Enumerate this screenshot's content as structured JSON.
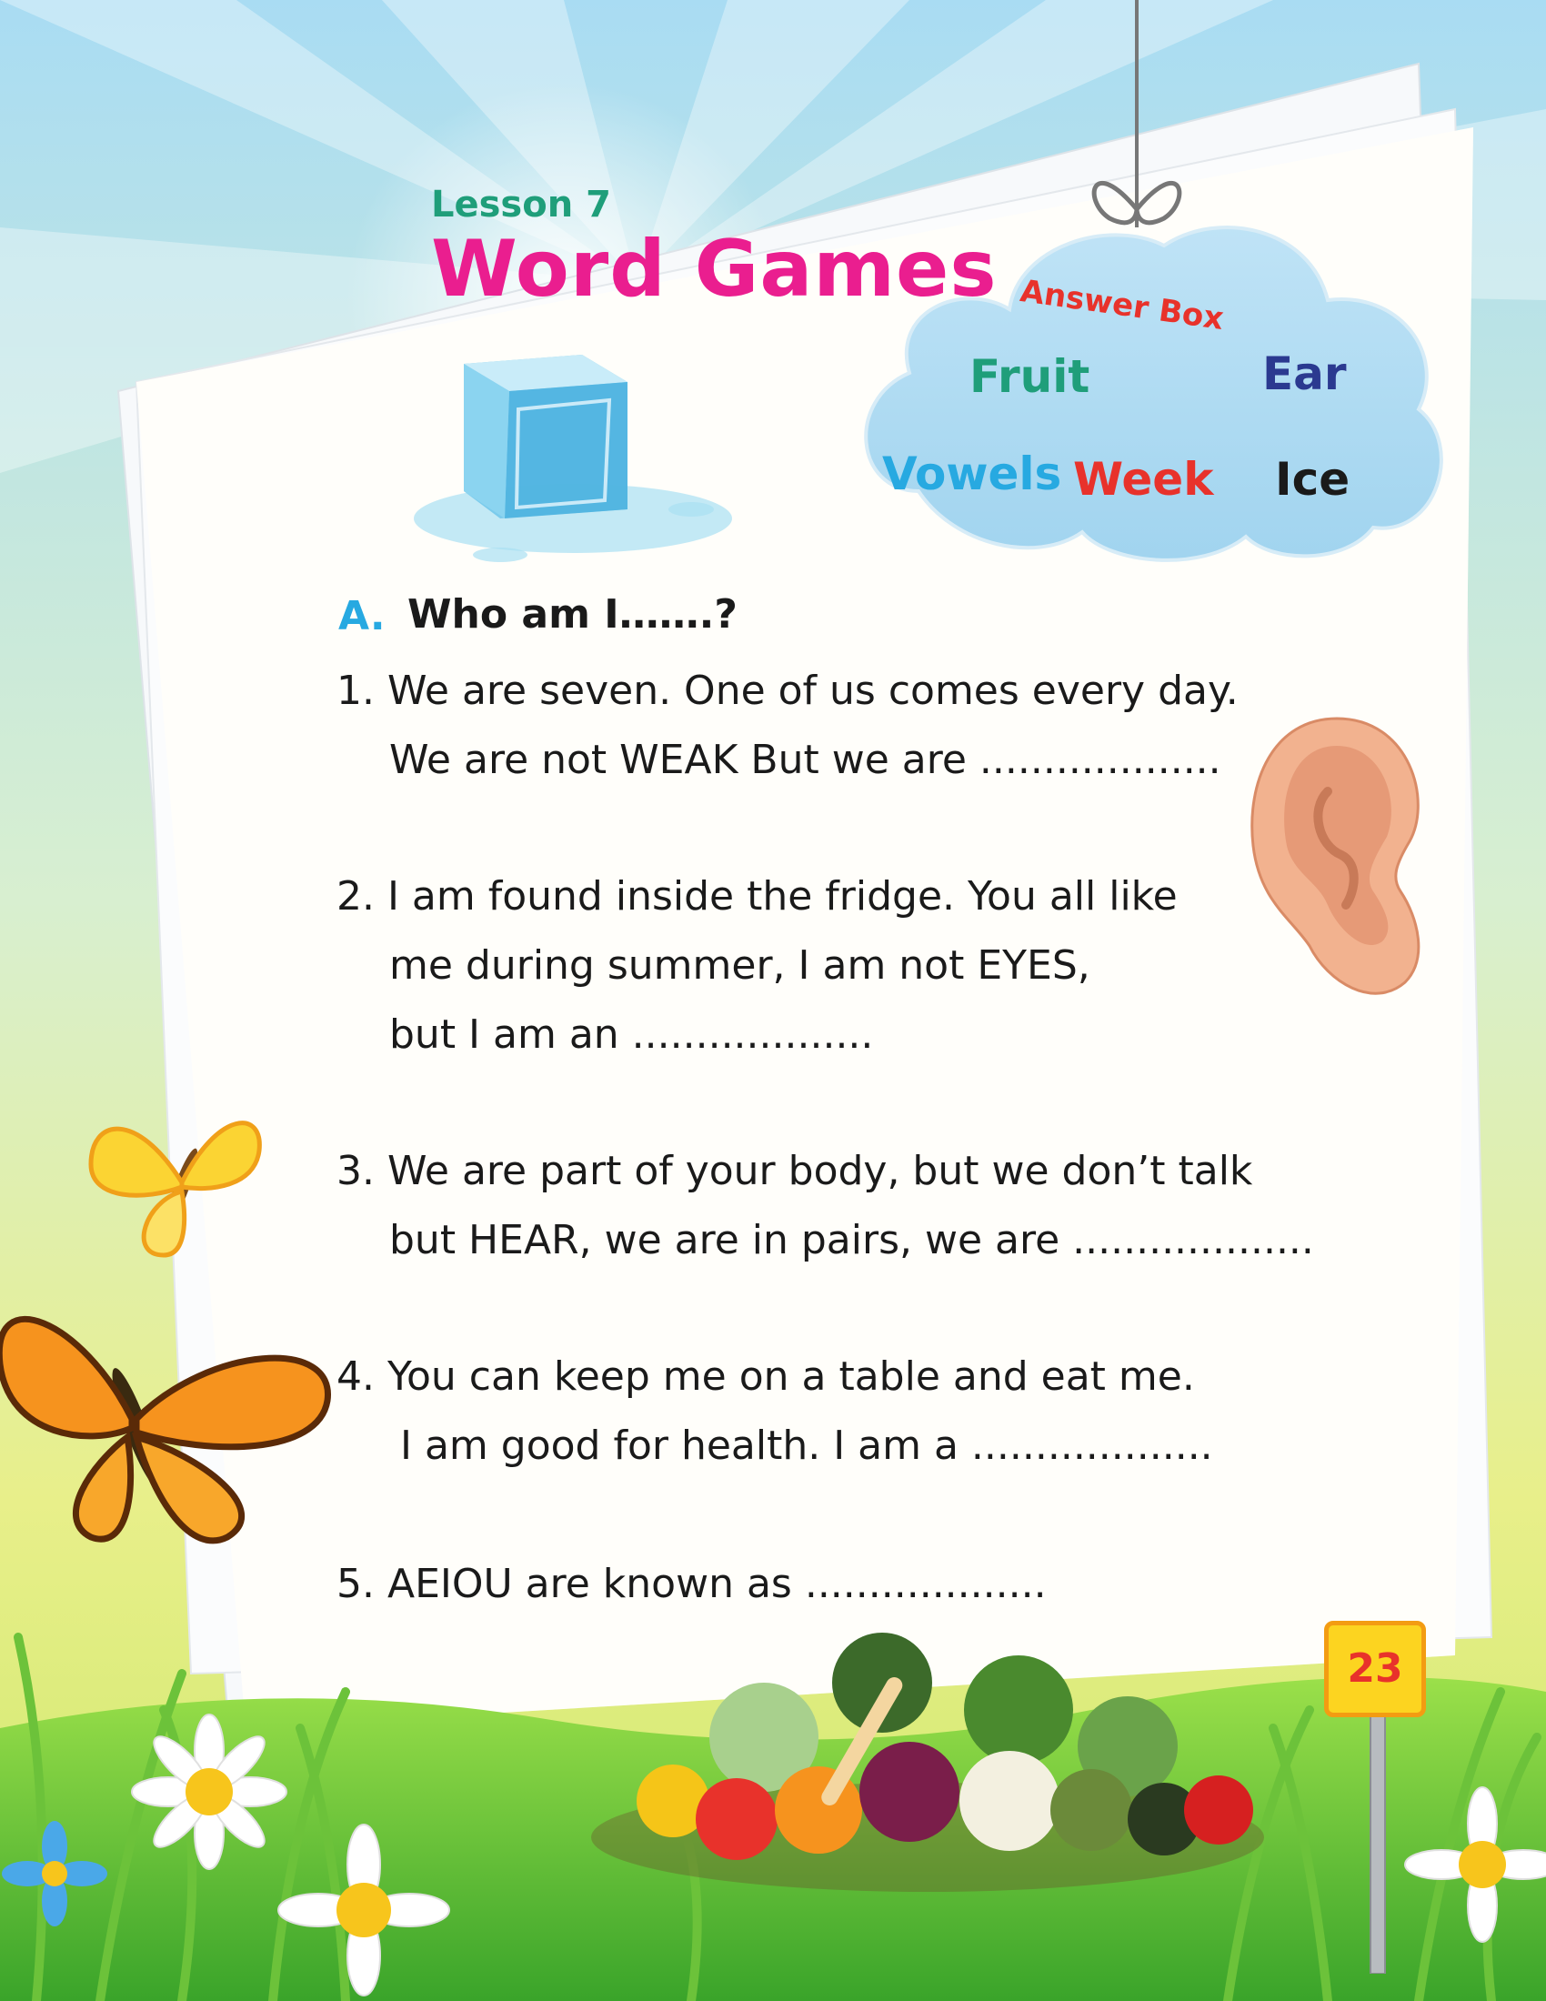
{
  "lesson_label": "Lesson 7",
  "title": "Word Games",
  "answer_box": {
    "title": "Answer Box",
    "words": [
      "Fruit",
      "Ear",
      "Vowels",
      "Week",
      "Ice"
    ],
    "colors": {
      "Fruit": "#1f9e7a",
      "Ear": "#2b3990",
      "Vowels": "#27a9e1",
      "Week": "#e8322b",
      "Ice": "#1a1a1a"
    }
  },
  "section": {
    "letter": "A.",
    "title": "Who am I…….?"
  },
  "questions": [
    {
      "lines": [
        "1. We are seven. One of us comes every day.",
        "We are not WEAK But we are ..................."
      ]
    },
    {
      "lines": [
        "2. I am found inside the fridge. You all like",
        "me during summer, I am not EYES,",
        "but I am an ..................."
      ]
    },
    {
      "lines": [
        "3. We are part of your body, but we don’t talk",
        "but HEAR, we are in pairs, we are ..................."
      ]
    },
    {
      "lines": [
        "4. You can keep me on a table and eat me.",
        "I am good for health. I am a ..................."
      ]
    },
    {
      "lines": [
        "5. AEIOU are known as ..................."
      ]
    }
  ],
  "page_number": "23",
  "icons": [
    "ice-cube-icon",
    "ear-icon",
    "butterfly-icon",
    "vegetables-icon",
    "daisy-icon",
    "cloud-icon",
    "signpost-icon"
  ],
  "colors": {
    "title": "#ea1e8f",
    "lesson": "#1f9e7a",
    "section_letter": "#27a9e1",
    "page_badge": "#fcd420"
  }
}
